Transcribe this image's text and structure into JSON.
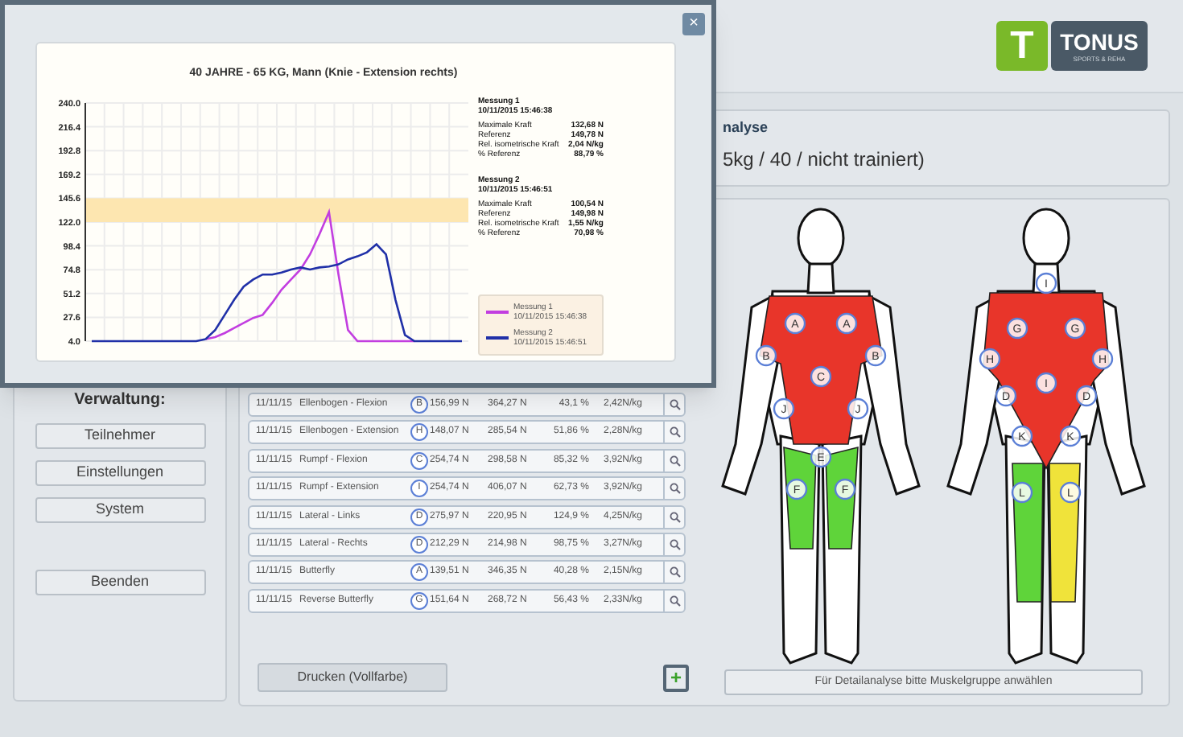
{
  "logo": {
    "letter": "T",
    "name": "TONUS",
    "tagline": "SPORTS & REHA"
  },
  "analysis": {
    "title": "nalyse",
    "subtitle": "5kg / 40 / nicht trainiert)"
  },
  "sidebar": {
    "heading": "Verwaltung:",
    "buttons": [
      "Teilnehmer",
      "Einstellungen",
      "System",
      "Beenden"
    ]
  },
  "results": [
    {
      "date": "11/11/15",
      "exercise": "Ellenbogen - Flexion",
      "group": "B",
      "force": "156,99 N",
      "reference": "364,27 N",
      "percent": "43,1 %",
      "relative": "2,42N/kg"
    },
    {
      "date": "11/11/15",
      "exercise": "Ellenbogen - Extension",
      "group": "H",
      "force": "148,07 N",
      "reference": "285,54 N",
      "percent": "51,86 %",
      "relative": "2,28N/kg"
    },
    {
      "date": "11/11/15",
      "exercise": "Rumpf - Flexion",
      "group": "C",
      "force": "254,74 N",
      "reference": "298,58 N",
      "percent": "85,32 %",
      "relative": "3,92N/kg"
    },
    {
      "date": "11/11/15",
      "exercise": "Rumpf - Extension",
      "group": "I",
      "force": "254,74 N",
      "reference": "406,07 N",
      "percent": "62,73 %",
      "relative": "3,92N/kg"
    },
    {
      "date": "11/11/15",
      "exercise": "Lateral - Links",
      "group": "D",
      "force": "275,97 N",
      "reference": "220,95 N",
      "percent": "124,9 %",
      "relative": "4,25N/kg"
    },
    {
      "date": "11/11/15",
      "exercise": "Lateral - Rechts",
      "group": "D",
      "force": "212,29 N",
      "reference": "214,98 N",
      "percent": "98,75 %",
      "relative": "3,27N/kg"
    },
    {
      "date": "11/11/15",
      "exercise": "Butterfly",
      "group": "A",
      "force": "139,51 N",
      "reference": "346,35 N",
      "percent": "40,28 %",
      "relative": "2,15N/kg"
    },
    {
      "date": "11/11/15",
      "exercise": "Reverse Butterfly",
      "group": "G",
      "force": "151,64 N",
      "reference": "268,72 N",
      "percent": "56,43 %",
      "relative": "2,33N/kg"
    }
  ],
  "print_button": "Drucken (Vollfarbe)",
  "add_button": "+",
  "detail_button": "Für Detailanalyse bitte Muskelgruppe anwählen",
  "figures": [
    {
      "kind": "front",
      "muscles": [
        {
          "color": "#e8352a"
        },
        {
          "color": "#5fd43a"
        }
      ],
      "markers": [
        "A",
        "A",
        "B",
        "B",
        "C",
        "J",
        "J",
        "E",
        "F",
        "F"
      ]
    },
    {
      "kind": "back",
      "muscles": [
        {
          "color": "#e8352a"
        },
        {
          "color": "#5fd43a"
        },
        {
          "color": "#f0e33a"
        }
      ],
      "markers": [
        "I",
        "G",
        "G",
        "H",
        "H",
        "I",
        "D",
        "D",
        "K",
        "K",
        "L",
        "L"
      ]
    }
  ],
  "popup": {
    "close": "×",
    "chart_data": {
      "type": "line",
      "title": "40 JAHRE - 65 KG, Mann (Knie - Extension rechts)",
      "ylim": [
        4.0,
        240.0
      ],
      "yticks": [
        {
          "value": 4.0,
          "label": "4.0"
        },
        {
          "value": 27.6,
          "label": "27.6"
        },
        {
          "value": 51.2,
          "label": "51.2"
        },
        {
          "value": 74.8,
          "label": "74.8"
        },
        {
          "value": 98.4,
          "label": "98.4"
        },
        {
          "value": 122.0,
          "label": "122.0"
        },
        {
          "value": 145.6,
          "label": "145.6"
        },
        {
          "value": 169.2,
          "label": "169.2"
        },
        {
          "value": 192.8,
          "label": "192.8"
        },
        {
          "value": 216.4,
          "label": "216.4"
        },
        {
          "value": 240.0,
          "label": "240.0"
        }
      ],
      "grid": true,
      "bands": [
        {
          "axis": "y",
          "from": 122.0,
          "to": 145.6
        }
      ],
      "series": [
        {
          "name": "Messung 1",
          "color": "#c23ee0",
          "values": [
            null,
            null,
            null,
            null,
            null,
            null,
            null,
            null,
            null,
            null,
            null,
            null,
            6,
            8,
            12,
            17,
            22,
            27,
            30,
            42,
            55,
            65,
            75,
            90,
            110,
            132,
            70,
            15,
            4,
            4,
            4,
            4,
            4,
            4,
            4,
            null,
            null,
            null,
            null,
            null
          ]
        },
        {
          "name": "Messung 2",
          "color": "#2030a8",
          "values": [
            4,
            4,
            4,
            4,
            4,
            4,
            4,
            4,
            4,
            4,
            4,
            4,
            6,
            15,
            30,
            45,
            58,
            65,
            70,
            70,
            72,
            75,
            77,
            75,
            77,
            78,
            80,
            85,
            88,
            92,
            100,
            90,
            45,
            10,
            4,
            4,
            4,
            4,
            4,
            4
          ]
        }
      ]
    },
    "legend": [
      {
        "date": "10/11/2015 15:46:38"
      },
      {
        "date": "10/11/2015 15:46:51"
      }
    ],
    "stats": [
      {
        "title": "Messung 1",
        "date": "10/11/2015 15:46:38",
        "rows": [
          {
            "label": "Maximale Kraft",
            "value": "132,68 N"
          },
          {
            "label": "Referenz",
            "value": "149,78 N"
          },
          {
            "label": "Rel. isometrische Kraft",
            "value": "2,04 N/kg"
          },
          {
            "label": "% Referenz",
            "value": "88,79 %"
          }
        ]
      },
      {
        "title": "Messung 2",
        "date": "10/11/2015 15:46:51",
        "rows": [
          {
            "label": "Maximale Kraft",
            "value": "100,54 N"
          },
          {
            "label": "Referenz",
            "value": "149,98 N"
          },
          {
            "label": "Rel. isometrische Kraft",
            "value": "1,55 N/kg"
          },
          {
            "label": "% Referenz",
            "value": "70,98 %"
          }
        ]
      }
    ]
  }
}
